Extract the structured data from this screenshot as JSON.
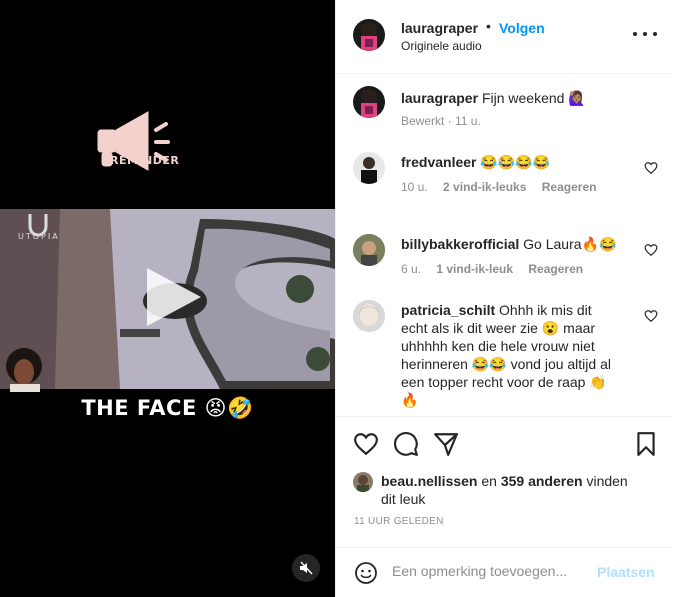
{
  "media": {
    "reminder_label": "REMINDER",
    "logo_text": "UTOPIA",
    "caption": "THE FACE 😡🤣"
  },
  "header": {
    "username": "lauragraper",
    "separator": "•",
    "follow_label": "Volgen",
    "audio_label": "Originele audio"
  },
  "caption_post": {
    "username": "lauragraper",
    "text": "Fijn weekend 🙋🏽‍♀️",
    "meta": "Bewerkt · 11 u."
  },
  "comments": [
    {
      "username": "fredvanleer",
      "text": "😂😂😂😂",
      "age": "10 u.",
      "likes": "2 vind-ik-leuks",
      "reply": "Reageren"
    },
    {
      "username": "billybakkerofficial",
      "text": "Go Laura🔥😂",
      "age": "6 u.",
      "likes": "1 vind-ik-leuk",
      "reply": "Reageren"
    },
    {
      "username": "patricia_schilt",
      "text_lines": [
        "Ohhh ik mis dit",
        "echt als ik dit weer zie 😮 maar",
        "uhhhhh ken die hele vrouw niet",
        "herinneren 😂😂 vond jou altijd al",
        "een topper recht voor de raap 👏",
        "🔥"
      ]
    }
  ],
  "likes": {
    "user": "beau.nellissen",
    "connector": "en",
    "others": "359 anderen",
    "suffix_1": "vinden",
    "suffix_2": "dit leuk"
  },
  "time_ago": "11 UUR GELEDEN",
  "add_comment": {
    "placeholder": "Een opmerking toevoegen...",
    "post_label": "Plaatsen"
  },
  "colors": {
    "accent": "#0095f6",
    "accent_disabled": "#b2dffc",
    "muted": "#8e8e8e",
    "text": "#262626",
    "reminder_pink": "#f3d2cd"
  }
}
